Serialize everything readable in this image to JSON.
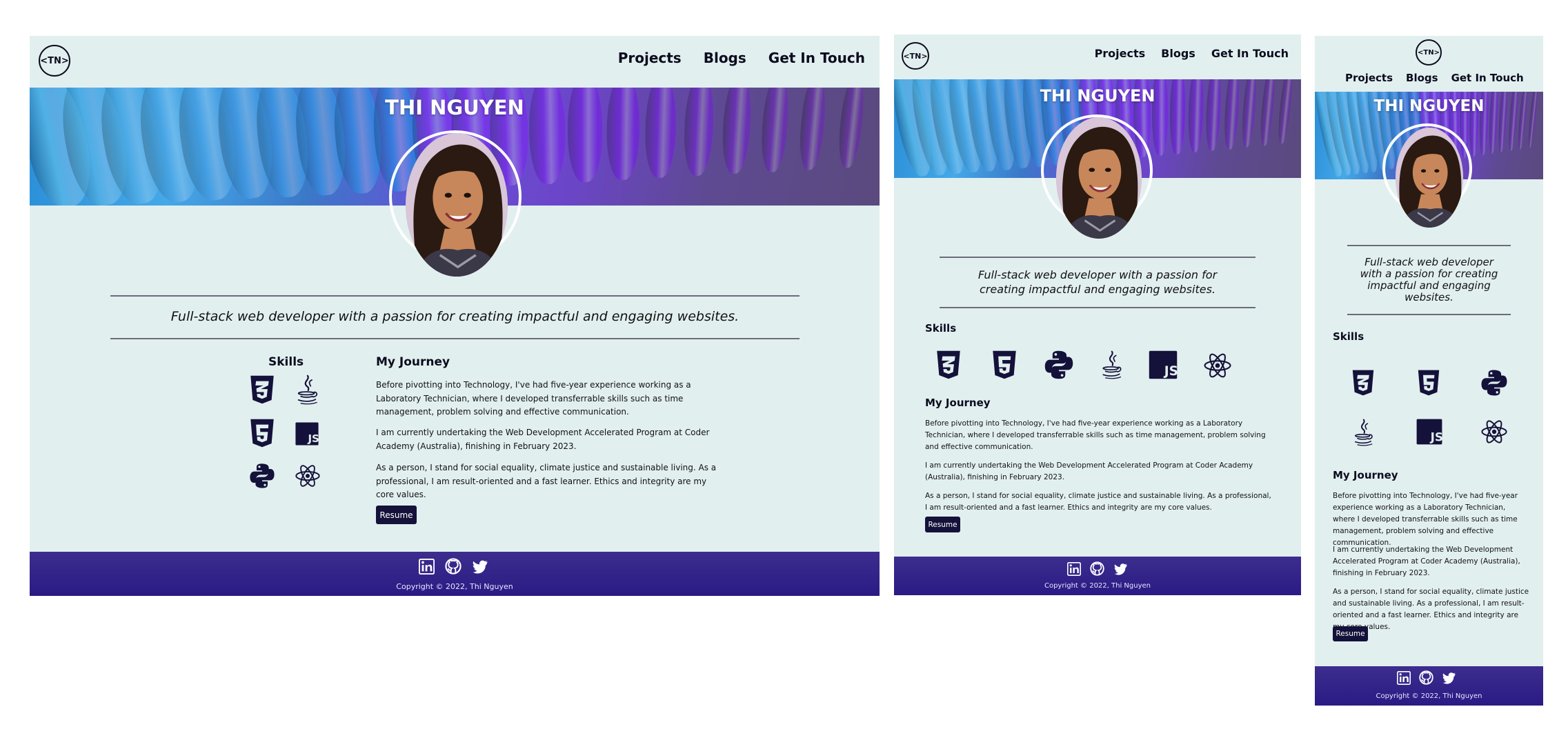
{
  "site": {
    "logo_text": "<TN>",
    "nav": [
      "Projects",
      "Blogs",
      "Get In Touch"
    ],
    "banner_name": "THI NGUYEN",
    "tagline": "Full-stack web developer with a passion for creating impactful and engaging websites.",
    "skills_title": "Skills",
    "skills": [
      "css3-icon",
      "html5-icon",
      "python-icon",
      "java-icon",
      "javascript-icon",
      "react-icon"
    ],
    "journey_title": "My Journey",
    "journey": [
      "Before pivotting into Technology, I've had five-year experience working as a Laboratory Technician, where I developed transferrable skills such as time management, problem solving and effective communication.",
      "I am currently undertaking the Web Development Accelerated Program at Coder Academy (Australia), finishing in February 2023.",
      "As a person, I stand for social equality, climate justice and sustainable living. As a professional, I am result-oriented and a fast learner. Ethics and integrity are my core values."
    ],
    "resume_label": "Resume",
    "social": [
      "linkedin-icon",
      "github-icon",
      "twitter-icon"
    ],
    "copyright": "Copyright © 2022, Thi Nguyen"
  },
  "colors": {
    "page_bg": "#e2efef",
    "text": "#0b0b1e",
    "icon": "#14113a",
    "button": "#14113a",
    "footer_top": "#3c2d8e",
    "footer_bottom": "#2a1a84"
  }
}
